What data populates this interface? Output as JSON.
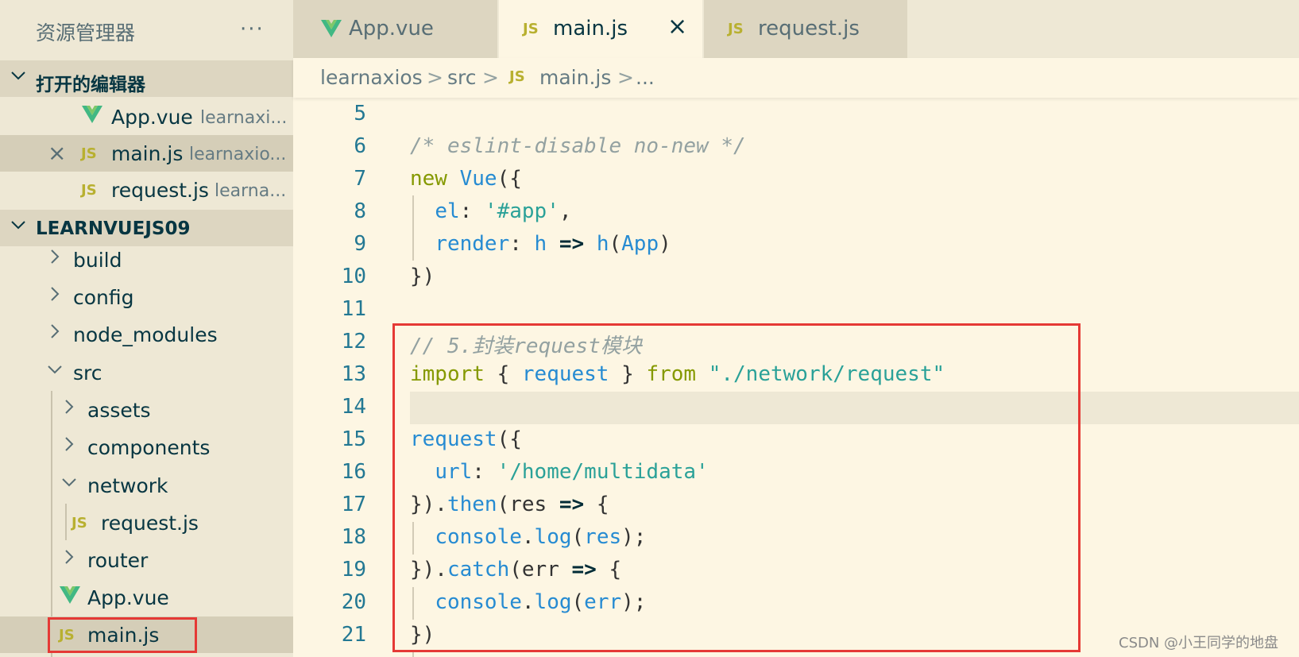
{
  "sidebar": {
    "title": "资源管理器",
    "more": "···",
    "open_editors": {
      "label": "打开的编辑器",
      "items": [
        {
          "name": "App.vue",
          "path": "learnaxi..."
        },
        {
          "name": "main.js",
          "path": "learnaxio..."
        },
        {
          "name": "request.js",
          "path": "learna..."
        }
      ]
    },
    "project": {
      "label": "LEARNVUEJS09",
      "tree": {
        "build": "build",
        "config": "config",
        "node_modules": "node_modules",
        "src": "src",
        "assets": "assets",
        "components": "components",
        "network": "network",
        "request_js": "request.js",
        "router": "router",
        "app_vue": "App.vue",
        "main_js": "main.js"
      }
    },
    "icons": {
      "js": "JS",
      "vue": "vue-logo-icon",
      "close": "×",
      "chevron": "chevron-icon"
    }
  },
  "tabs": [
    {
      "label": "App.vue",
      "icon": "vue-logo-icon"
    },
    {
      "label": "main.js",
      "icon": "JS",
      "active": true
    },
    {
      "label": "request.js",
      "icon": "JS"
    }
  ],
  "breadcrumb": {
    "parts": [
      "learnaxios",
      "src",
      "main.js",
      "..."
    ],
    "sep": ">",
    "js_icon": "JS"
  },
  "editor": {
    "line_numbers": [
      "5",
      "6",
      "7",
      "8",
      "9",
      "10",
      "11",
      "12",
      "13",
      "14",
      "15",
      "16",
      "17",
      "18",
      "19",
      "20",
      "21"
    ]
  },
  "colors": {
    "background": "#fdf6e3",
    "sidebar": "#eee8d5",
    "keyword": "#859900",
    "identifier": "#268bd2",
    "string": "#2aa198",
    "comment": "#93a1a1",
    "line_number": "#237893",
    "highlight_box": "#e53935"
  },
  "watermark": "CSDN @小王同学的地盘"
}
